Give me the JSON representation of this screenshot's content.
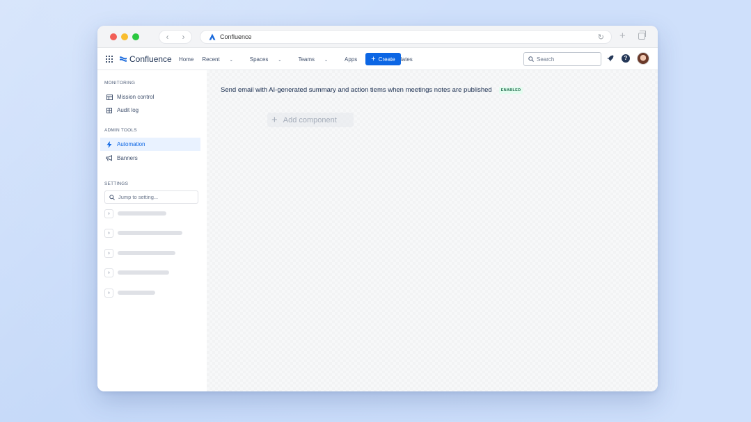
{
  "browser": {
    "url_text": "Confluence",
    "back_glyph": "‹",
    "forward_glyph": "›",
    "reload_glyph": "↻",
    "newtab_glyph": "+"
  },
  "topnav": {
    "brand": "Confluence",
    "links": [
      "Home",
      "Recent",
      "Spaces",
      "Teams",
      "Apps",
      "Templates"
    ],
    "dropdown_caret": "⌄",
    "create_label": "Create",
    "search_placeholder": "Search",
    "help_glyph": "?"
  },
  "sidebar": {
    "monitoring_header": "MONITORING",
    "mission_control": "Mission control",
    "audit_log": "Audit log",
    "admin_tools_header": "ADMIN TOOLS",
    "automation": "Automation",
    "banners": "Banners",
    "settings_header": "SETTINGS",
    "jump_placeholder": "Jump to setting...",
    "collapsed_rows": 5
  },
  "main": {
    "rule_title": "Send email with AI-generated summary and action tiems when meetings notes are published",
    "status_badge": "ENABLED",
    "add_component": "Add component"
  },
  "colors": {
    "accent": "#0c66e4",
    "enabled_green": "#216e4e",
    "page_background": "#cfe0fb"
  }
}
